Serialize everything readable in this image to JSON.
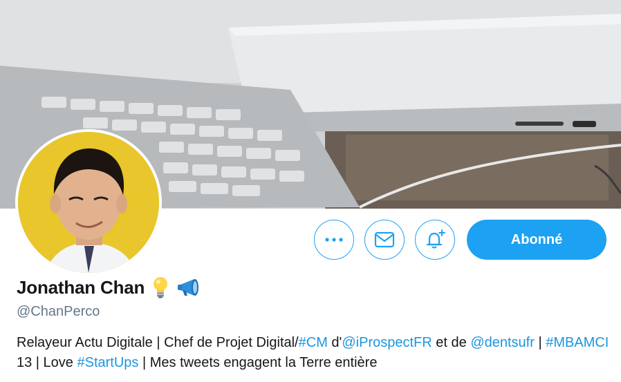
{
  "profile": {
    "name": "Jonathan Chan",
    "name_emojis": [
      "lightbulb-icon",
      "megaphone-icon"
    ],
    "handle": "@ChanPerco",
    "bio": {
      "t1": "Relayeur Actu Digitale | Chef de Projet Digital/",
      "l1": "#CM",
      "t2": " d'",
      "l2": "@iProspectFR",
      "t3": " et de ",
      "l3": "@dentsufr",
      "t4": " | ",
      "l4": "#MBAMCI",
      "t5": " 13 | Love ",
      "l5": "#StartUps",
      "t6": " | Mes tweets engagent la Terre entière"
    }
  },
  "actions": {
    "more_icon": "more-icon",
    "message_icon": "envelope-icon",
    "notify_icon": "bell-plus-icon",
    "follow_label": "Abonné"
  },
  "colors": {
    "accent": "#1da1f2",
    "link": "#1b95e0",
    "text": "#14171a",
    "secondary": "#657786",
    "avatar_bg": "#e8c62c"
  }
}
